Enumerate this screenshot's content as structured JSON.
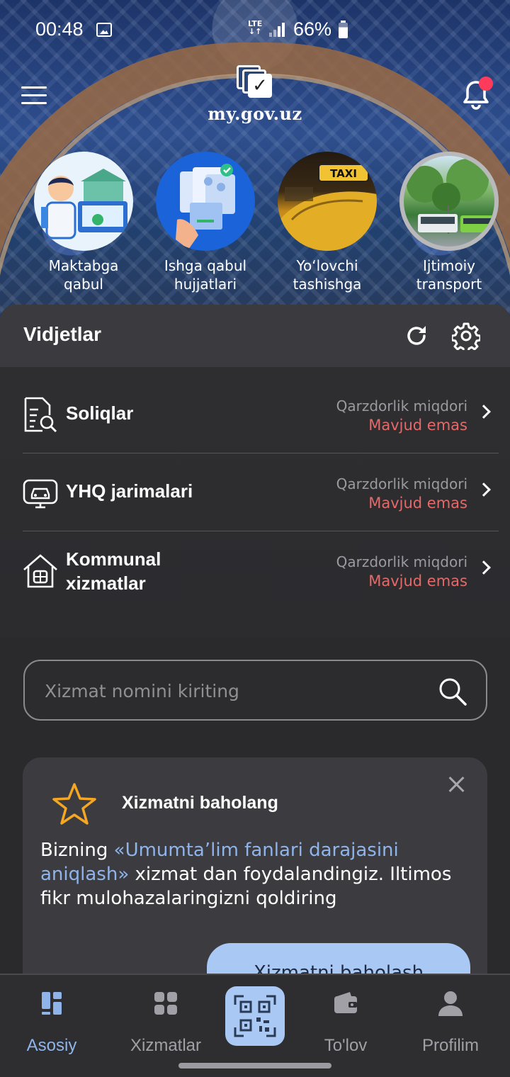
{
  "status_bar": {
    "time": "00:48",
    "network": "LTE",
    "battery": "66%"
  },
  "header": {
    "brand": "my.gov.uz",
    "notification_badge": true
  },
  "stories": [
    {
      "label": "Maktabga qabul"
    },
    {
      "label": "Ishga qabul hujjatlari"
    },
    {
      "label": "Yo‘lovchi tashishga"
    },
    {
      "label": "Ijtimoiy transport"
    }
  ],
  "widgets": {
    "title": "Vidjetlar",
    "items": [
      {
        "name": "Soliqlar",
        "meta_label": "Qarzdorlik miqdori",
        "meta_value": "Mavjud emas",
        "icon": "tax-document-icon"
      },
      {
        "name": "YHQ jarimalari",
        "meta_label": "Qarzdorlik miqdori",
        "meta_value": "Mavjud emas",
        "icon": "car-fine-icon"
      },
      {
        "name_line1": "Kommunal",
        "name_line2": "xizmatlar",
        "meta_label": "Qarzdorlik miqdori",
        "meta_value": "Mavjud emas",
        "icon": "house-icon"
      }
    ]
  },
  "search": {
    "placeholder": "Xizmat nomini kiriting",
    "value": ""
  },
  "rating_card": {
    "title": "Xizmatni baholang",
    "text_prefix": "Bizning ",
    "service_name": "«Umumta’lim fanlari darajasini aniqlash»",
    "text_suffix": " xizmat dan foydalandingiz. Iltimos fikr mulohazalaringizni qoldiring",
    "button": "Xizmatni baholash"
  },
  "bottom_nav": {
    "items": [
      {
        "label": "Asosiy",
        "active": true
      },
      {
        "label": "Xizmatlar",
        "active": false
      },
      {
        "label": "To'lov",
        "active": false
      },
      {
        "label": "Profilim",
        "active": false
      }
    ]
  },
  "colors": {
    "accent": "#8fb4ea",
    "debt_value": "#e46a6a",
    "badge": "#ff3b5c"
  }
}
